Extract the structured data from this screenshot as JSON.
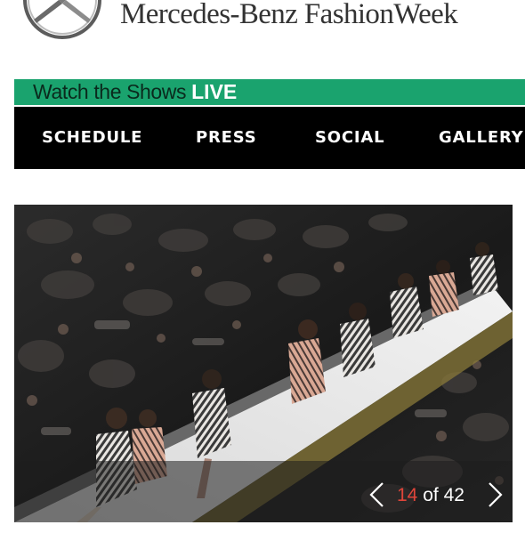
{
  "header": {
    "brand_title": "Mercedes-Benz FashionWeek",
    "logo_icon": "mercedes-star-icon"
  },
  "live_banner": {
    "prefix": "Watch the Shows",
    "live_word": "LIVE",
    "colors": {
      "background": "#1aa36e",
      "prefix_text": "#0a2a1d",
      "live_text": "#ffffff"
    }
  },
  "nav": {
    "background": "#000000",
    "items": [
      {
        "label": "SCHEDULE"
      },
      {
        "label": "PRESS"
      },
      {
        "label": "SOCIAL"
      },
      {
        "label": "GALLERY"
      }
    ]
  },
  "gallery": {
    "current": "14",
    "of_word": "of",
    "total": "42",
    "prev_icon": "chevron-left-icon",
    "next_icon": "chevron-right-icon",
    "current_color": "#e0453a"
  }
}
